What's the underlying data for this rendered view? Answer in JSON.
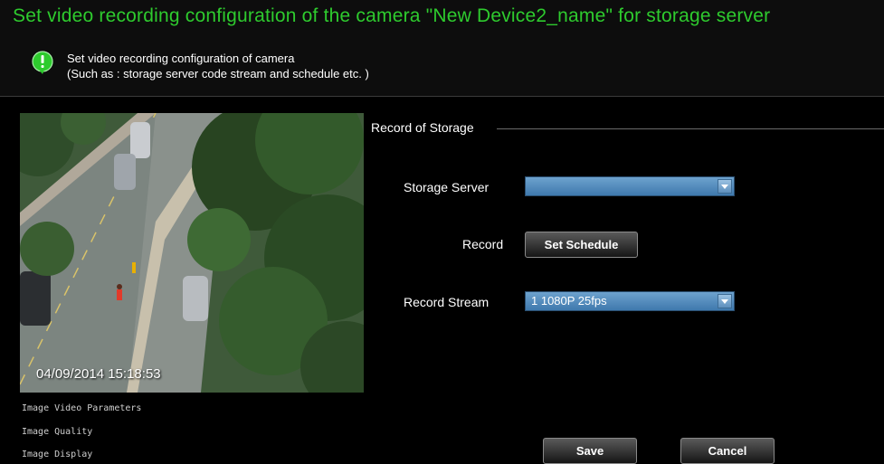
{
  "header": {
    "title": "Set video recording configuration of the camera \"New Device2_name\" for storage server",
    "subtitle_line1": "Set video recording configuration of camera",
    "subtitle_line2": "(Such as : storage server code stream and schedule etc. )",
    "icon": "info-bubble-icon"
  },
  "preview": {
    "timestamp": "04/09/2014  15:18:53"
  },
  "side_menu": {
    "items": [
      "Image Video Parameters",
      "Image Quality",
      "Image Display"
    ]
  },
  "record_group": {
    "title": "Record of Storage",
    "storage_server_label": "Storage Server",
    "storage_server_value": "",
    "record_label": "Record",
    "set_schedule_label": "Set Schedule",
    "record_stream_label": "Record Stream",
    "record_stream_value": "1 1080P 25fps"
  },
  "footer": {
    "save_label": "Save",
    "cancel_label": "Cancel"
  },
  "colors": {
    "title": "#2ecb2e",
    "select_fill": "#4f88bb",
    "background": "#000000"
  }
}
